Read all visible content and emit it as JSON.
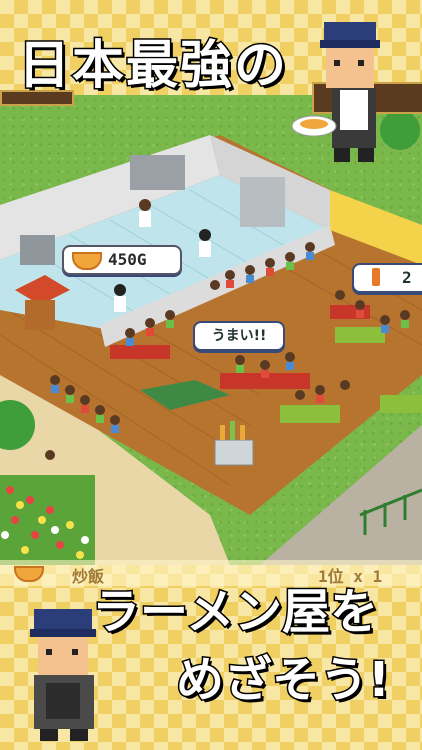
{
  "headline_top": "日本最強の",
  "headline_bottom_1": "ラーメン屋を",
  "headline_bottom_2": "めざそう!",
  "hud": {
    "price_tag": "450G",
    "speech_bubble": "うまい!!",
    "right_counter": "2",
    "bottom_menu": "炒飯",
    "bottom_stats": "1位 x 1"
  },
  "colors": {
    "accent_red": "#e8432b",
    "accent_green": "#7ab84c",
    "floor_wood": "#b7742f",
    "kitchen_tile": "#bfe4ec",
    "checker_light": "#f7e6a4",
    "checker_dark": "#f0cf63"
  },
  "icons": [
    "ramen-bowl-icon",
    "coin-icon",
    "bottle-icon",
    "chef-character",
    "waiter-character"
  ]
}
